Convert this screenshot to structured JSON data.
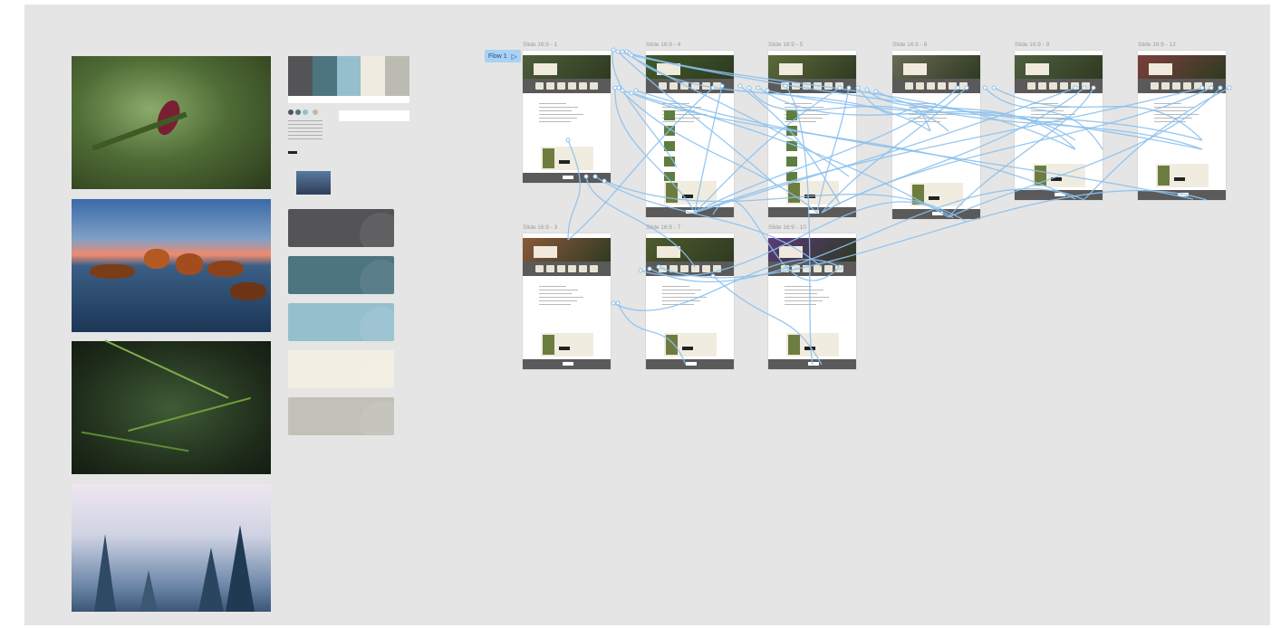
{
  "flow": {
    "label": "Flow 1",
    "play_icon": "play-icon"
  },
  "frames": [
    {
      "title": "Slide 16:9 - 1",
      "hero_color": "#4d5e39"
    },
    {
      "title": "Slide 16:9 - 4",
      "hero_color": "#3f5a2a"
    },
    {
      "title": "Slide 16:9 - 5",
      "hero_color": "#5d6a3a"
    },
    {
      "title": "Slide 16:9 - 8",
      "hero_color": "#6a6a55"
    },
    {
      "title": "Slide 16:9 - 9",
      "hero_color": "#4e5f3e"
    },
    {
      "title": "Slide 16:9 - 12",
      "hero_color": "#7a3f3c"
    },
    {
      "title": "Slide 16:9 - 3",
      "hero_color": "#8a5a3a"
    },
    {
      "title": "Slide 16:9 - 7",
      "hero_color": "#4f5a2c"
    },
    {
      "title": "Slide 16:9 - 10",
      "hero_color": "#5a3a78"
    }
  ],
  "palette": {
    "colors": [
      "#545456",
      "#4c7580",
      "#95bfcd",
      "#efebe0",
      "#bcbbb2"
    ],
    "swatches": [
      "#545456",
      "#4c7580",
      "#95bfcd",
      "#f2eee3",
      "#c2c1b8"
    ]
  },
  "photos": [
    "pine-cone-photo",
    "sunset-rocks-photo",
    "pine-needles-photo",
    "misty-forest-photo"
  ],
  "colors": {
    "canvas": "#e5e5e5",
    "wire": "#8cc1ee",
    "accent": "#a8d1f4"
  }
}
